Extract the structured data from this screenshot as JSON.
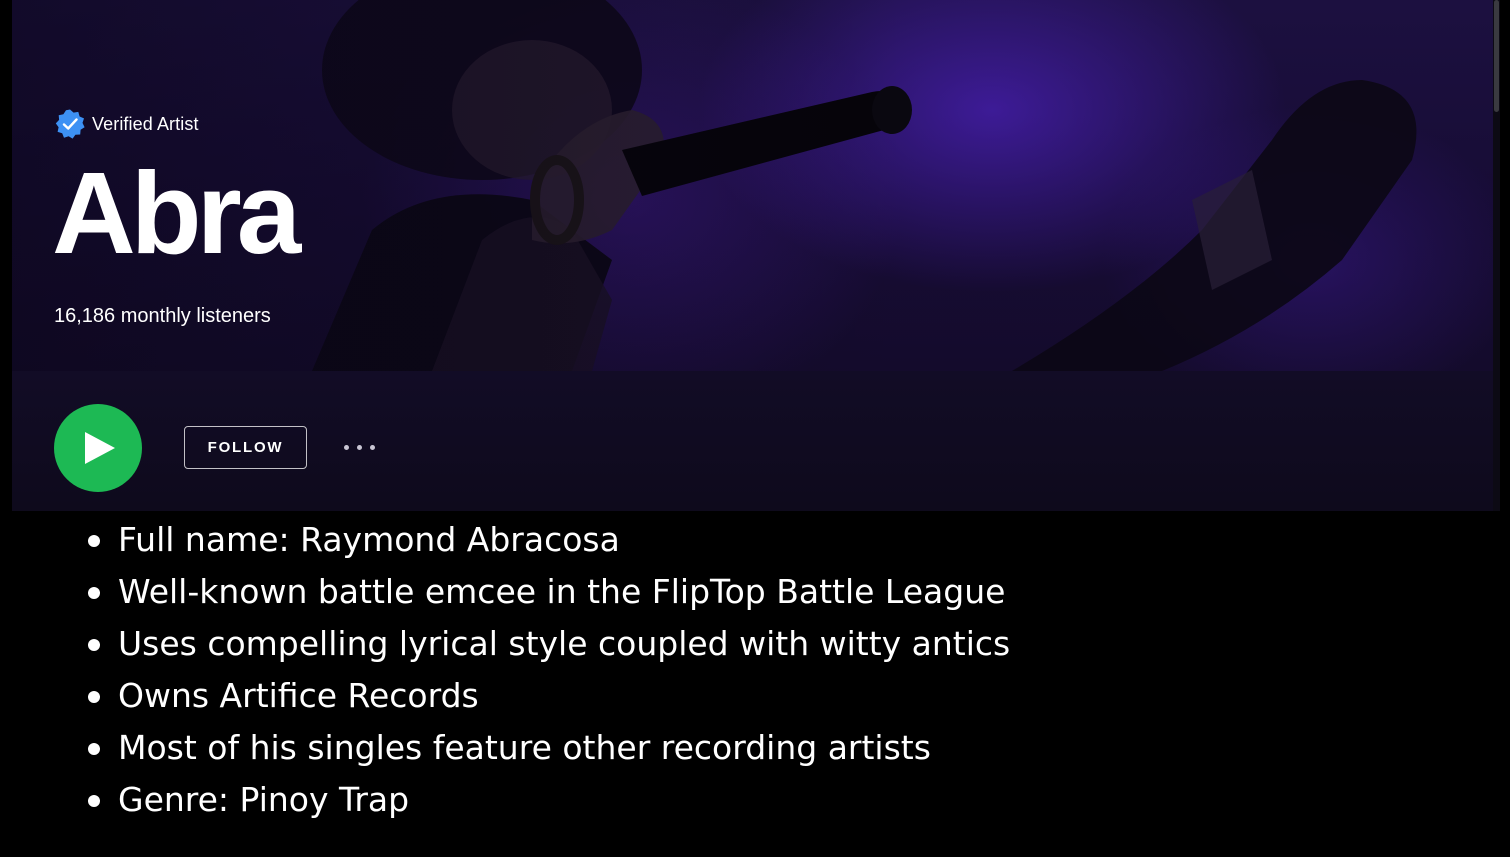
{
  "artist": {
    "verified_label": "Verified Artist",
    "name": "Abra",
    "monthly_listeners": "16,186 monthly listeners"
  },
  "actions": {
    "follow_label": "FOLLOW"
  },
  "icons": {
    "verified": "verified-badge-icon",
    "play": "play-icon",
    "more": "more-options-icon"
  },
  "colors": {
    "play_button": "#1db954",
    "verified_badge": "#3d91f4",
    "hero_tint": "#1c1040",
    "page_background": "#000000"
  },
  "facts": [
    "Full name: Raymond Abracosa",
    "Well-known battle emcee in the FlipTop Battle League",
    "Uses compelling lyrical style coupled with witty antics",
    "Owns Artifice Records",
    "Most of his singles feature other recording artists",
    "Genre: Pinoy Trap"
  ]
}
